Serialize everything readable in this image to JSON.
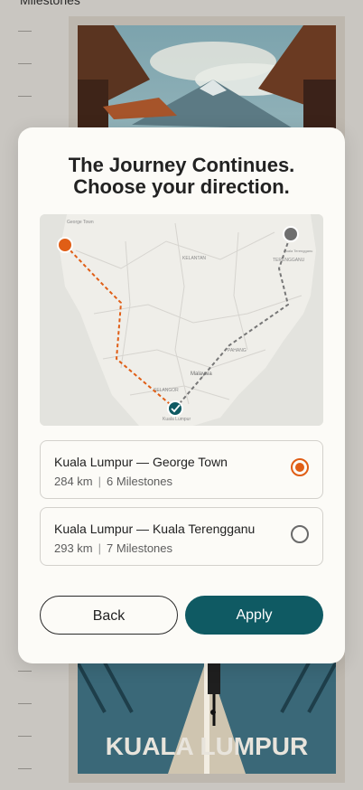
{
  "background": {
    "top_text": "Milestones",
    "poster_title": "KUALA LUMPUR"
  },
  "modal": {
    "title_line1": "The Journey Continues.",
    "title_line2": "Choose your direction."
  },
  "map": {
    "labels": {
      "george_town": "George Town",
      "kelantan": "KELANTAN",
      "terengganu": "TERENGGANU",
      "pahang": "PAHANG",
      "selangor": "SELANGOR",
      "malaysia": "Malaysia",
      "kuala_lumpur": "Kuala Lumpur",
      "kuala_terengganu": "Kuala Terengganu"
    },
    "colors": {
      "route_selected": "#e05e16",
      "route_other": "#777777",
      "start_marker": "#0f5a63"
    }
  },
  "routes": [
    {
      "name": "Kuala Lumpur — George Town",
      "distance": "284 km",
      "milestones": "6 Milestones",
      "selected": true
    },
    {
      "name": "Kuala Lumpur — Kuala Terengganu",
      "distance": "293 km",
      "milestones": "7 Milestones",
      "selected": false
    }
  ],
  "buttons": {
    "back": "Back",
    "apply": "Apply"
  },
  "colors": {
    "accent": "#e05e16",
    "primary": "#0f5a63",
    "modal_bg": "#fcfbf7"
  }
}
